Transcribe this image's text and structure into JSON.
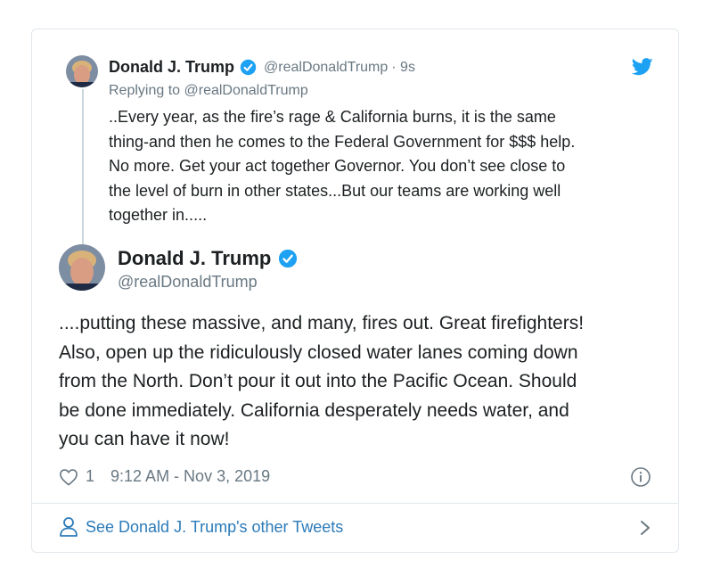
{
  "parent_tweet": {
    "name": "Donald J. Trump",
    "handle": "@realDonaldTrump",
    "time": "· 9s",
    "replying_to": "Replying to @realDonaldTrump",
    "text": "..Every year, as the fire’s rage & California burns, it is the same\nthing-and then he comes to the Federal Government for $$$ help.\nNo more. Get your act together Governor. You don’t see close to\nthe level of burn in other states...But our teams are working well\ntogether in....."
  },
  "main_tweet": {
    "name": "Donald J. Trump",
    "handle": "@realDonaldTrump",
    "text": "....putting these massive, and many, fires out. Great firefighters!\nAlso, open up the ridiculously closed water lanes coming down\nfrom the North. Don’t pour it out into the Pacific Ocean. Should\nbe done immediately. California desperately needs water, and\nyou can have it now!",
    "likes": "1",
    "timestamp": "9:12 AM - Nov 3, 2019"
  },
  "footer": {
    "link_label": "See Donald J. Trump's other Tweets"
  },
  "icons": {
    "verified": "verified-badge-icon",
    "twitter": "twitter-bird-icon",
    "like": "heart-icon",
    "info": "info-icon",
    "person": "person-icon",
    "chevron": "chevron-right-icon"
  },
  "colors": {
    "accent": "#1da1f2",
    "link": "#2b7bb9",
    "secondary_text": "#697882",
    "border": "#e1e8ed"
  }
}
